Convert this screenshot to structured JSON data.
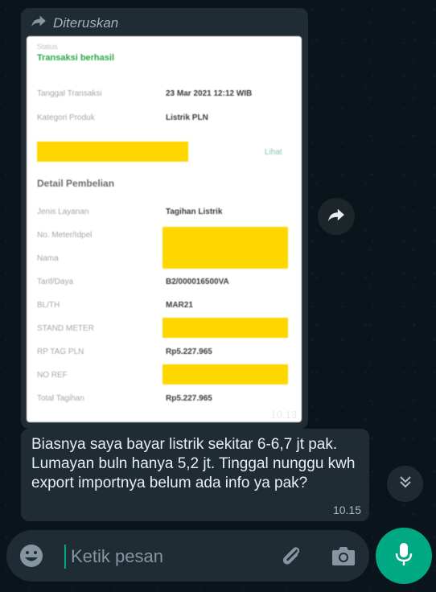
{
  "forwarded_message": {
    "forwarded_label": "Diteruskan",
    "timestamp": "10.13",
    "receipt": {
      "status_caption": "Status",
      "status": "Transaksi berhasil",
      "transaction_date_label": "Tanggal Transaksi",
      "transaction_date_value": "23 Mar 2021 12:12  WIB",
      "product_category_label": "Kategori Produk",
      "product_category_value": "Listrik PLN",
      "see_link": "Lihat",
      "detail_heading": "Detail Pembelian",
      "rows": [
        {
          "label": "Jenis Layanan",
          "value": "Tagihan Listrik"
        },
        {
          "label": "No. Meter/Idpel",
          "value": ""
        },
        {
          "label": "Nama",
          "value": ""
        },
        {
          "label": "Tarif/Daya",
          "value": "B2/000016500VA"
        },
        {
          "label": "BL/TH",
          "value": "MAR21"
        },
        {
          "label": "STAND METER",
          "value": ""
        },
        {
          "label": "RP TAG PLN",
          "value": "Rp5.227.965"
        },
        {
          "label": "NO REF",
          "value": ""
        },
        {
          "label": "Total Tagihan",
          "value": "Rp5.227.965"
        }
      ],
      "highlight_color": "#ffd700"
    }
  },
  "text_message": {
    "text": "Biasnya saya bayar listrik sekitar 6-6,7 jt pak. Lumayan buln hanya 5,2 jt. Tinggal nunggu kwh export importnya belum ada info ya pak?",
    "timestamp": "10.15"
  },
  "input_bar": {
    "placeholder": "Ketik pesan"
  },
  "icons": {
    "forward": "forward-arrow-icon",
    "share": "share-icon",
    "scroll_down": "double-chevron-down-icon",
    "emoji": "emoji-icon",
    "attach": "paperclip-icon",
    "camera": "camera-icon",
    "mic": "microphone-icon"
  },
  "colors": {
    "background": "#0b141a",
    "bubble": "#1f2c34",
    "accent": "#00a884",
    "text": "#e9edef",
    "success_green": "#28a745"
  }
}
